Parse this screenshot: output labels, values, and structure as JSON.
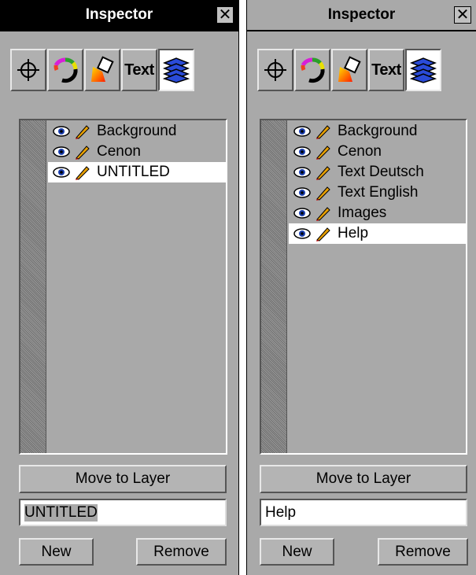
{
  "panels": [
    {
      "title": "Inspector",
      "close_glyph": "✕",
      "toolbar": [
        {
          "icon": "crosshair-icon"
        },
        {
          "icon": "color-wheel-icon"
        },
        {
          "icon": "paint-bucket-icon"
        },
        {
          "icon": "text-tool",
          "label": "Text"
        },
        {
          "icon": "layers-icon",
          "active": true
        }
      ],
      "layers": [
        {
          "name": "Background",
          "selected": false
        },
        {
          "name": "Cenon",
          "selected": false
        },
        {
          "name": "UNTITLED",
          "selected": true
        }
      ],
      "move_button": "Move to Layer",
      "name_field": "UNTITLED",
      "new_button": "New",
      "remove_button": "Remove"
    },
    {
      "title": "Inspector",
      "close_glyph": "✕",
      "toolbar": [
        {
          "icon": "crosshair-icon"
        },
        {
          "icon": "color-wheel-icon"
        },
        {
          "icon": "paint-bucket-icon"
        },
        {
          "icon": "text-tool",
          "label": "Text"
        },
        {
          "icon": "layers-icon",
          "active": true
        }
      ],
      "layers": [
        {
          "name": "Background",
          "selected": false
        },
        {
          "name": "Cenon",
          "selected": false
        },
        {
          "name": "Text Deutsch",
          "selected": false
        },
        {
          "name": "Text English",
          "selected": false
        },
        {
          "name": "Images",
          "selected": false
        },
        {
          "name": "Help",
          "selected": true
        }
      ],
      "move_button": "Move to Layer",
      "name_field": "Help",
      "new_button": "New",
      "remove_button": "Remove"
    }
  ]
}
